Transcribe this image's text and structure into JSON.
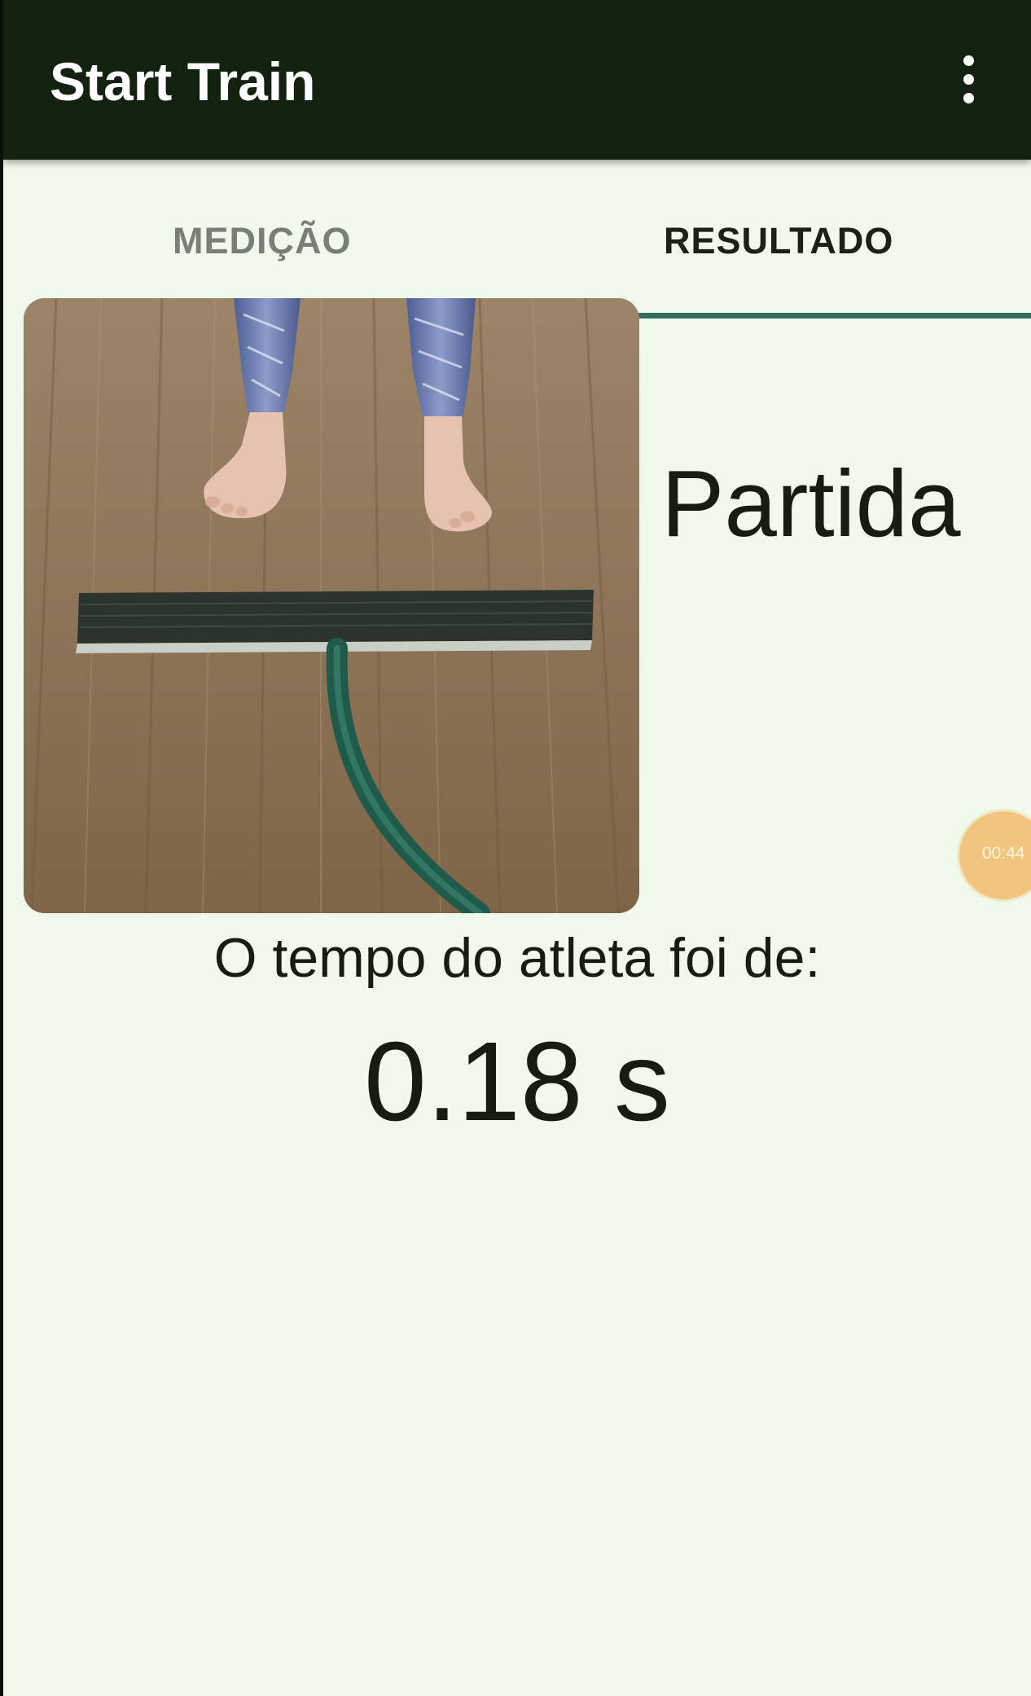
{
  "app_bar": {
    "title": "Start Train",
    "menu_icon": "more-vert-icon"
  },
  "tabs": [
    {
      "label": "MEDIÇÃO",
      "selected": false
    },
    {
      "label": "RESULTADO",
      "selected": true
    }
  ],
  "result": {
    "start_label": "Partida",
    "caption": "O tempo do atleta foi de:",
    "time_value": "0.18 s"
  },
  "floating_timer": {
    "text": "00:44"
  },
  "colors": {
    "app_bar": "#13210f",
    "background": "#f0faec",
    "tab_indicator": "#2f6e5f",
    "timer_bubble": "#f1c57e"
  }
}
